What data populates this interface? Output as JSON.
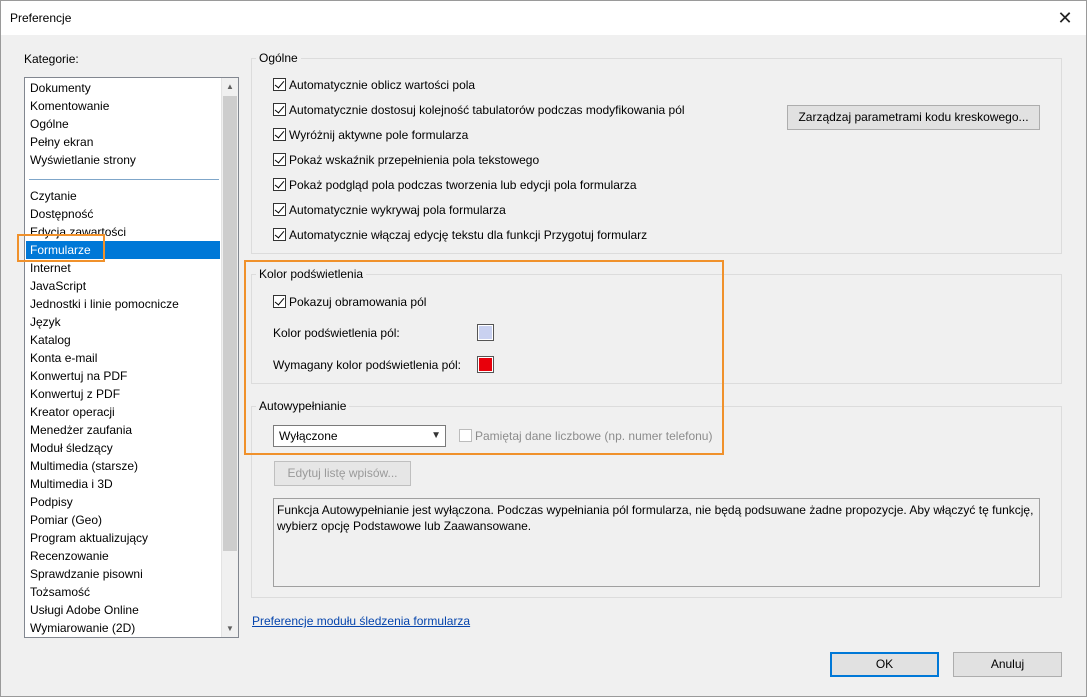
{
  "window": {
    "title": "Preferencje",
    "close_icon": "close-icon"
  },
  "categories": {
    "label": "Kategorie:",
    "group1": [
      "Dokumenty",
      "Komentowanie",
      "Ogólne",
      "Pełny ekran",
      "Wyświetlanie strony"
    ],
    "group2": [
      "Czytanie",
      "Dostępność",
      "Edycja zawartości",
      "Formularze",
      "Internet",
      "JavaScript",
      "Jednostki i linie pomocnicze",
      "Język",
      "Katalog",
      "Konta e-mail",
      "Konwertuj na PDF",
      "Konwertuj z PDF",
      "Kreator operacji",
      "Menedżer zaufania",
      "Moduł śledzący",
      "Multimedia (starsze)",
      "Multimedia i 3D",
      "Podpisy",
      "Pomiar (Geo)",
      "Program aktualizujący",
      "Recenzowanie",
      "Sprawdzanie pisowni",
      "Tożsamość",
      "Usługi Adobe Online",
      "Wymiarowanie (2D)"
    ],
    "selected": "Formularze"
  },
  "general": {
    "title": "Ogólne",
    "options": [
      {
        "label": "Automatycznie oblicz wartości pola",
        "checked": true
      },
      {
        "label": "Automatycznie dostosuj kolejność tabulatorów podczas modyfikowania pól",
        "checked": true
      },
      {
        "label": "Wyróżnij aktywne pole formularza",
        "checked": true
      },
      {
        "label": "Pokaż wskaźnik przepełnienia pola tekstowego",
        "checked": true
      },
      {
        "label": "Pokaż podgląd pola podczas tworzenia lub edycji pola formularza",
        "checked": true
      },
      {
        "label": "Automatycznie wykrywaj pola formularza",
        "checked": true
      },
      {
        "label": "Automatycznie włączaj edycję tekstu dla funkcji Przygotuj formularz",
        "checked": true
      }
    ],
    "barcode_button": "Zarządzaj parametrami kodu kreskowego..."
  },
  "highlight": {
    "title": "Kolor podświetlenia",
    "show_borders": "Pokazuj obramowania pól",
    "field_color_label": "Kolor podświetlenia pól:",
    "required_color_label": "Wymagany kolor podświetlenia pól:",
    "field_color": "#c9d1f0",
    "required_color": "#e8000b"
  },
  "autofill": {
    "title": "Autowypełnianie",
    "mode": "Wyłączone",
    "remember_numeric": "Pamiętaj dane liczbowe (np. numer telefonu)",
    "edit_button": "Edytuj listę wpisów...",
    "description": "Funkcja Autowypełnianie jest wyłączona. Podczas wypełniania pól formularza, nie będą podsuwane żadne propozycje. Aby włączyć tę funkcję, wybierz opcję Podstawowe lub Zaawansowane."
  },
  "tracker_link": "Preferencje modułu śledzenia formularza",
  "buttons": {
    "ok": "OK",
    "cancel": "Anuluj"
  },
  "accent": {
    "highlight_frame": "#f0912b",
    "selection": "#0078d7"
  }
}
